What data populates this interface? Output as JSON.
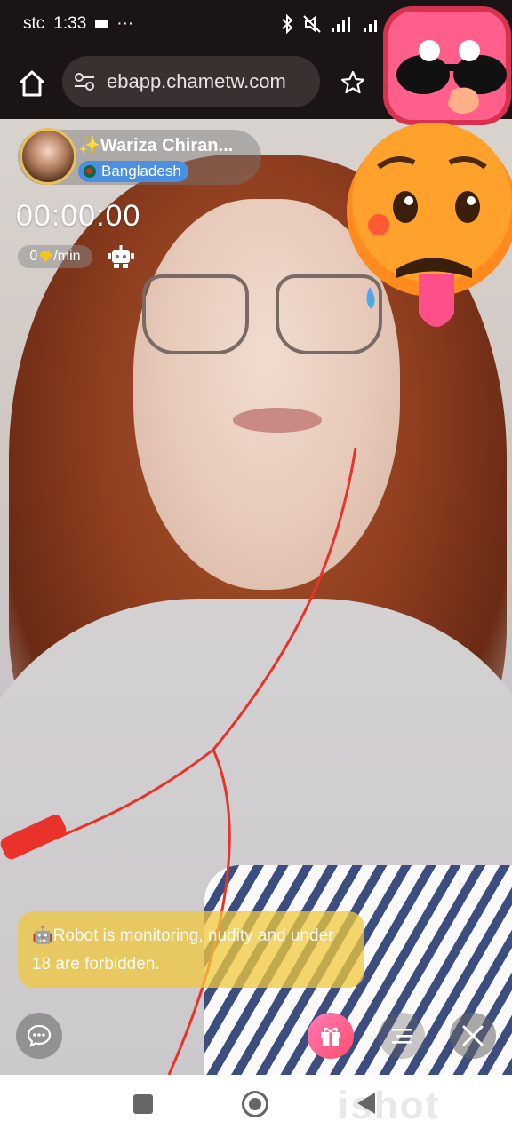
{
  "status_bar": {
    "carrier": "stc",
    "time": "1:33",
    "more": "···"
  },
  "browser": {
    "url": "ebapp.chametw.com",
    "icons": [
      "home-icon",
      "tune-icon",
      "star-icon"
    ]
  },
  "host": {
    "name": "✨Wariza Chiran...",
    "country": "Bangladesh"
  },
  "call": {
    "timer": "00:00:00",
    "rate_value": "0",
    "rate_unit": "/min"
  },
  "notice": {
    "text": "🤖Robot is monitoring, nudity and under 18 are forbidden."
  },
  "watermark": "ishot",
  "colors": {
    "gift_button": "#ff5f8a",
    "notice_bg": "#f0c83c",
    "country_badge": "#4a8fe0"
  }
}
